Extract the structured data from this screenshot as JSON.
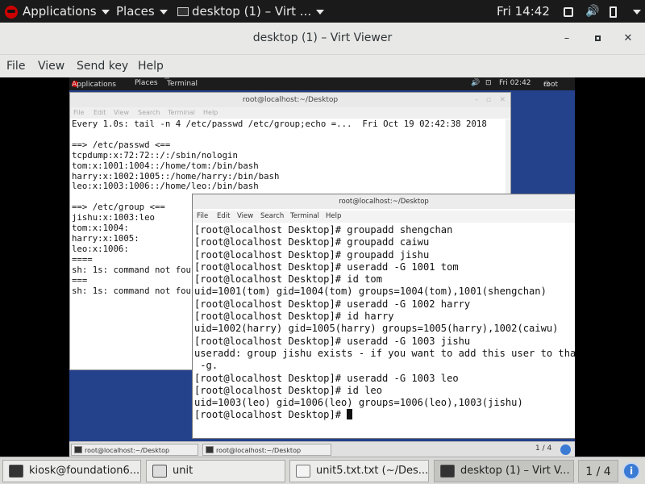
{
  "host_panel": {
    "applications": "Applications",
    "places": "Places",
    "active_window": "desktop (1) – Virt ...",
    "clock": "Fri 14:42"
  },
  "viewer": {
    "title": "desktop (1) – Virt Viewer",
    "menu": [
      "File",
      "View",
      "Send key",
      "Help"
    ]
  },
  "guest": {
    "panel": {
      "applications": "Applications",
      "places": "Places",
      "terminal_btn": "Terminal",
      "clock": "Fri 02:42",
      "user": "root"
    },
    "term1": {
      "title": "root@localhost:~/Desktop",
      "menu": [
        "File",
        "Edit",
        "View",
        "Search",
        "Terminal",
        "Help"
      ],
      "content": "Every 1.0s: tail -n 4 /etc/passwd /etc/group;echo =...  Fri Oct 19 02:42:38 2018\n\n==> /etc/passwd <==\ntcpdump:x:72:72::/:/sbin/nologin\ntom:x:1001:1004::/home/tom:/bin/bash\nharry:x:1002:1005::/home/harry:/bin/bash\nleo:x:1003:1006::/home/leo:/bin/bash\n\n==> /etc/group <==\njishu:x:1003:leo\ntom:x:1004:\nharry:x:1005:\nleo:x:1006:\n====\nsh: 1s: command not found\n===\nsh: 1s: command not found"
    },
    "term2": {
      "title": "root@localhost:~/Desktop",
      "menu": [
        "File",
        "Edit",
        "View",
        "Search",
        "Terminal",
        "Help"
      ],
      "content": "[root@localhost Desktop]# groupadd shengchan\n[root@localhost Desktop]# groupadd caiwu\n[root@localhost Desktop]# groupadd jishu\n[root@localhost Desktop]# useradd -G 1001 tom\n[root@localhost Desktop]# id tom\nuid=1001(tom) gid=1004(tom) groups=1004(tom),1001(shengchan)\n[root@localhost Desktop]# useradd -G 1002 harry\n[root@localhost Desktop]# id harry\nuid=1002(harry) gid=1005(harry) groups=1005(harry),1002(caiwu)\n[root@localhost Desktop]# useradd -G 1003 jishu\nuseradd: group jishu exists - if you want to add this user to that group, use\n -g.\n[root@localhost Desktop]# useradd -G 1003 leo\n[root@localhost Desktop]# id leo\nuid=1003(leo) gid=1006(leo) groups=1006(leo),1003(jishu)\n[root@localhost Desktop]# "
    },
    "taskbar": {
      "items": [
        "root@localhost:~/Desktop",
        "root@localhost:~/Desktop"
      ],
      "workspace": "1 / 4"
    }
  },
  "host_taskbar": {
    "items": [
      "kiosk@foundation6...",
      "unit",
      "unit5.txt.txt (~/Des...",
      "desktop (1) – Virt V..."
    ],
    "workspace": "1 / 4"
  }
}
